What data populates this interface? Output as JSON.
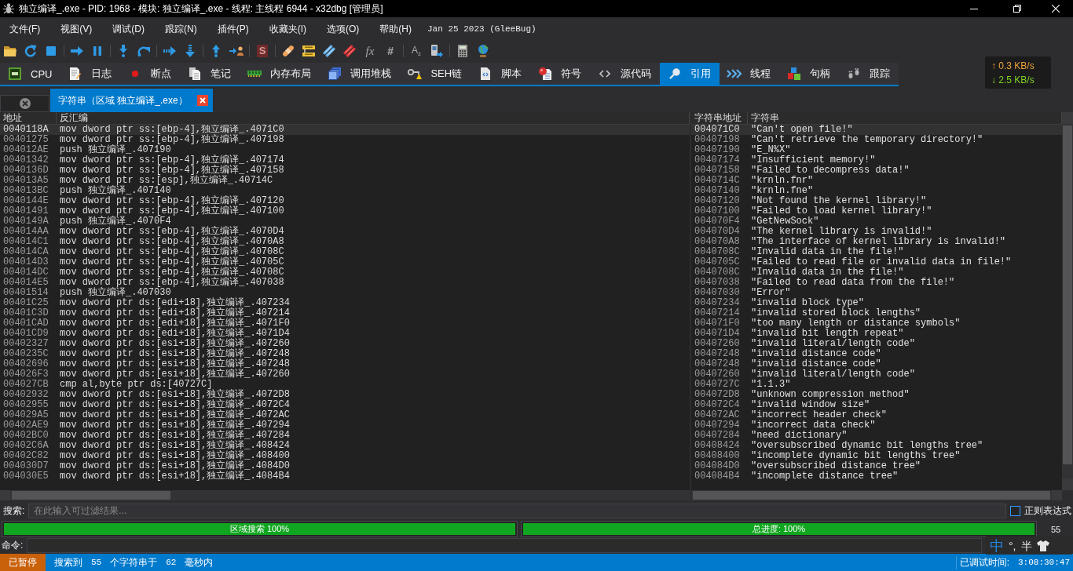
{
  "window": {
    "title": "独立编译_.exe - PID: 1968 - 模块: 独立编译_.exe - 线程: 主线程 6944 - x32dbg [管理员]"
  },
  "menu": {
    "items": [
      "文件(F)",
      "视图(V)",
      "调试(D)",
      "跟踪(N)",
      "插件(P)",
      "收藏夹(I)",
      "选项(O)",
      "帮助(H)"
    ],
    "build": "Jan 25 2023 (GleeBug)"
  },
  "toolbar": {
    "glyphs": [
      "S",
      "fx",
      "#",
      "A$_{z}$"
    ]
  },
  "tabs": [
    {
      "label": "CPU",
      "selected": false
    },
    {
      "label": "日志",
      "selected": false
    },
    {
      "label": "断点",
      "selected": false
    },
    {
      "label": "笔记",
      "selected": false
    },
    {
      "label": "内存布局",
      "selected": false
    },
    {
      "label": "调用堆栈",
      "selected": false
    },
    {
      "label": "SEH链",
      "selected": false
    },
    {
      "label": "脚本",
      "selected": false
    },
    {
      "label": "符号",
      "selected": false
    },
    {
      "label": "源代码",
      "selected": false
    },
    {
      "label": "引用",
      "selected": true
    },
    {
      "label": "线程",
      "selected": false
    },
    {
      "label": "句柄",
      "selected": false
    },
    {
      "label": "跟踪",
      "selected": false
    }
  ],
  "network_meter": {
    "upload": "↑ 0.3 KB/s",
    "download": "↓ 2.5 KB/s"
  },
  "reference_tabs": [
    {
      "label": "字符串（区域 独立编译_.exe）",
      "selected": true
    }
  ],
  "table": {
    "columns": [
      "地址",
      "反汇编",
      "字符串地址",
      "字符串"
    ],
    "rows": [
      {
        "address": "0040118A",
        "disassembly": "mov dword ptr ss:[ebp-4],独立编译_.4071C0",
        "string_address": "004071C0",
        "string": "\"Can't open file!\"",
        "selected": true
      },
      {
        "address": "00401275",
        "disassembly": "mov dword ptr ss:[ebp-4],独立编译_.407198",
        "string_address": "00407198",
        "string": "\"Can't retrieve the temporary directory!\"",
        "selected": false
      },
      {
        "address": "004012AE",
        "disassembly": "push 独立编译_.407190",
        "string_address": "00407190",
        "string": "\"E_N%X\"",
        "selected": false
      },
      {
        "address": "00401342",
        "disassembly": "mov dword ptr ss:[ebp-4],独立编译_.407174",
        "string_address": "00407174",
        "string": "\"Insufficient memory!\"",
        "selected": false
      },
      {
        "address": "0040136D",
        "disassembly": "mov dword ptr ss:[ebp-4],独立编译_.407158",
        "string_address": "00407158",
        "string": "\"Failed to decompress data!\"",
        "selected": false
      },
      {
        "address": "004013A5",
        "disassembly": "mov dword ptr ss:[esp],独立编译_.40714C",
        "string_address": "0040714C",
        "string": "\"krnln.fnr\"",
        "selected": false
      },
      {
        "address": "004013BC",
        "disassembly": "push 独立编译_.407140",
        "string_address": "00407140",
        "string": "\"krnln.fne\"",
        "selected": false
      },
      {
        "address": "0040144E",
        "disassembly": "mov dword ptr ss:[ebp-4],独立编译_.407120",
        "string_address": "00407120",
        "string": "\"Not found the kernel library!\"",
        "selected": false
      },
      {
        "address": "00401491",
        "disassembly": "mov dword ptr ss:[ebp-4],独立编译_.407100",
        "string_address": "00407100",
        "string": "\"Failed to load kernel library!\"",
        "selected": false
      },
      {
        "address": "0040149A",
        "disassembly": "push 独立编译_.4070F4",
        "string_address": "004070F4",
        "string": "\"GetNewSock\"",
        "selected": false
      },
      {
        "address": "004014AA",
        "disassembly": "mov dword ptr ss:[ebp-4],独立编译_.4070D4",
        "string_address": "004070D4",
        "string": "\"The kernel library is invalid!\"",
        "selected": false
      },
      {
        "address": "004014C1",
        "disassembly": "mov dword ptr ss:[ebp-4],独立编译_.4070A8",
        "string_address": "004070A8",
        "string": "\"The interface of kernel library is invalid!\"",
        "selected": false
      },
      {
        "address": "004014CA",
        "disassembly": "mov dword ptr ss:[ebp-4],独立编译_.40708C",
        "string_address": "0040708C",
        "string": "\"Invalid data in the file!\"",
        "selected": false
      },
      {
        "address": "004014D3",
        "disassembly": "mov dword ptr ss:[ebp-4],独立编译_.40705C",
        "string_address": "0040705C",
        "string": "\"Failed to read file or invalid data in file!\"",
        "selected": false
      },
      {
        "address": "004014DC",
        "disassembly": "mov dword ptr ss:[ebp-4],独立编译_.40708C",
        "string_address": "0040708C",
        "string": "\"Invalid data in the file!\"",
        "selected": false
      },
      {
        "address": "004014E5",
        "disassembly": "mov dword ptr ss:[ebp-4],独立编译_.407038",
        "string_address": "00407038",
        "string": "\"Failed to read data from the file!\"",
        "selected": false
      },
      {
        "address": "00401514",
        "disassembly": "push 独立编译_.407030",
        "string_address": "00407030",
        "string": "\"Error\"",
        "selected": false
      },
      {
        "address": "00401C25",
        "disassembly": "mov dword ptr ds:[edi+18],独立编译_.407234",
        "string_address": "00407234",
        "string": "\"invalid block type\"",
        "selected": false
      },
      {
        "address": "00401C3D",
        "disassembly": "mov dword ptr ds:[edi+18],独立编译_.407214",
        "string_address": "00407214",
        "string": "\"invalid stored block lengths\"",
        "selected": false
      },
      {
        "address": "00401CAD",
        "disassembly": "mov dword ptr ds:[edi+18],独立编译_.4071F0",
        "string_address": "004071F0",
        "string": "\"too many length or distance symbols\"",
        "selected": false
      },
      {
        "address": "00401CD9",
        "disassembly": "mov dword ptr ds:[edi+18],独立编译_.4071D4",
        "string_address": "004071D4",
        "string": "\"invalid bit length repeat\"",
        "selected": false
      },
      {
        "address": "00402327",
        "disassembly": "mov dword ptr ds:[esi+18],独立编译_.407260",
        "string_address": "00407260",
        "string": "\"invalid literal/length code\"",
        "selected": false
      },
      {
        "address": "0040235C",
        "disassembly": "mov dword ptr ds:[esi+18],独立编译_.407248",
        "string_address": "00407248",
        "string": "\"invalid distance code\"",
        "selected": false
      },
      {
        "address": "00402696",
        "disassembly": "mov dword ptr ds:[esi+18],独立编译_.407248",
        "string_address": "00407248",
        "string": "\"invalid distance code\"",
        "selected": false
      },
      {
        "address": "004026F3",
        "disassembly": "mov dword ptr ds:[esi+18],独立编译_.407260",
        "string_address": "00407260",
        "string": "\"invalid literal/length code\"",
        "selected": false
      },
      {
        "address": "004027CB",
        "disassembly": "cmp al,byte ptr ds:[40727C]",
        "string_address": "0040727C",
        "string": "\"1.1.3\"",
        "selected": false
      },
      {
        "address": "00402932",
        "disassembly": "mov dword ptr ds:[esi+18],独立编译_.4072D8",
        "string_address": "004072D8",
        "string": "\"unknown compression method\"",
        "selected": false
      },
      {
        "address": "00402955",
        "disassembly": "mov dword ptr ds:[esi+18],独立编译_.4072C4",
        "string_address": "004072C4",
        "string": "\"invalid window size\"",
        "selected": false
      },
      {
        "address": "004029A5",
        "disassembly": "mov dword ptr ds:[esi+18],独立编译_.4072AC",
        "string_address": "004072AC",
        "string": "\"incorrect header check\"",
        "selected": false
      },
      {
        "address": "00402AE9",
        "disassembly": "mov dword ptr ds:[esi+18],独立编译_.407294",
        "string_address": "00407294",
        "string": "\"incorrect data check\"",
        "selected": false
      },
      {
        "address": "00402BC0",
        "disassembly": "mov dword ptr ds:[esi+18],独立编译_.407284",
        "string_address": "00407284",
        "string": "\"need dictionary\"",
        "selected": false
      },
      {
        "address": "00402C6A",
        "disassembly": "mov dword ptr ds:[esi+18],独立编译_.408424",
        "string_address": "00408424",
        "string": "\"oversubscribed dynamic bit lengths tree\"",
        "selected": false
      },
      {
        "address": "00402C82",
        "disassembly": "mov dword ptr ds:[esi+18],独立编译_.408400",
        "string_address": "00408400",
        "string": "\"incomplete dynamic bit lengths tree\"",
        "selected": false
      },
      {
        "address": "004030D7",
        "disassembly": "mov dword ptr ds:[esi+18],独立编译_.4084D0",
        "string_address": "004084D0",
        "string": "\"oversubscribed distance tree\"",
        "selected": false
      },
      {
        "address": "004030E5",
        "disassembly": "mov dword ptr ds:[esi+18],独立编译_.4084B4",
        "string_address": "004084B4",
        "string": "\"incomplete distance tree\"",
        "selected": false
      }
    ]
  },
  "search": {
    "label": "搜索:",
    "placeholder": "在此输入可过滤结果...",
    "regex": {
      "label": "正则表达式",
      "checked": false
    }
  },
  "progress": [
    {
      "label": "区域搜索 100%",
      "level": 1
    },
    {
      "label": "总进度: 100%",
      "level": 1
    }
  ],
  "progress_count": "55",
  "command": {
    "label": "命令:"
  },
  "ime": {
    "mode": "中",
    "punctuation": "°,",
    "width": "半"
  },
  "status_bar": {
    "state": "已暂停",
    "items": [
      {
        "text": "搜索到",
        "kind": "label"
      },
      {
        "text": "55",
        "kind": "value"
      },
      {
        "text": "个字符串于",
        "kind": "label"
      },
      {
        "text": "62",
        "kind": "value"
      },
      {
        "text": "毫秒内",
        "kind": "label"
      }
    ],
    "elapsed_label": "已调试时间:",
    "elapsed": "3:08:30:47"
  }
}
